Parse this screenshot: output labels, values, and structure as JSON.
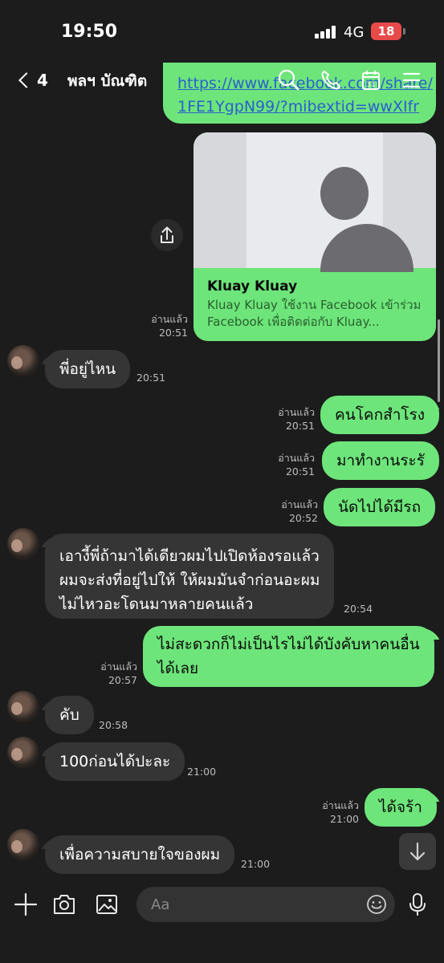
{
  "status_bar": {
    "time": "19:50",
    "network": "4G",
    "battery": "18"
  },
  "header": {
    "back_count": "4",
    "title": "พลฯ บัณฑิต"
  },
  "link_message": {
    "url_line1": "https://www.facebook.com/share/",
    "url_line2": "1FE1YgpN99/?mibextid=wwXIfr"
  },
  "link_card": {
    "title": "Kluay Kluay",
    "description": "Kluay Kluay ใช้งาน Facebook เข้าร่วม Facebook เพื่อติดต่อกับ Kluay...",
    "read": "อ่านแล้ว",
    "time": "20:51"
  },
  "messages": [
    {
      "dir": "in",
      "text": "พี่อยู่ไหน",
      "time": "20:51"
    },
    {
      "dir": "out",
      "text": "คนโคกสำโรง",
      "read": "อ่านแล้ว",
      "time": "20:51"
    },
    {
      "dir": "out",
      "text": "มาทำงานระรั",
      "read": "อ่านแล้ว",
      "time": "20:51"
    },
    {
      "dir": "out",
      "text": "นัดไปได้มีรถ",
      "read": "อ่านแล้ว",
      "time": "20:52"
    },
    {
      "dir": "in",
      "lines": [
        "เอางี้พี่ถ้ามาได้เดียวผมไปเปิดห้องรอแล้ว",
        "ผมจะส่งที่อยู่ไปให้ ให้ผมมันจำก่อนอะผม",
        "ไม่ไหวอะโดนมาหลายคนแล้ว"
      ],
      "time": "20:54"
    },
    {
      "dir": "out",
      "lines": [
        "ไม่สะดวกก็ไม่เป็นไรไม่ได้บังคับหาคนอื่น",
        "ได้เลย"
      ],
      "read": "อ่านแล้ว",
      "time": "20:57"
    },
    {
      "dir": "in",
      "text": "คับ",
      "time": "20:58"
    },
    {
      "dir": "in",
      "text": "100ก่อนได้ปะละ",
      "time": "21:00"
    },
    {
      "dir": "out",
      "text": "ได้จร้า",
      "read": "อ่านแล้ว",
      "time": "21:00"
    },
    {
      "dir": "in",
      "text": "เพื่อความสบายใจของผม",
      "time": "21:00"
    }
  ],
  "input": {
    "placeholder": "Aa"
  },
  "colors": {
    "background": "#1c1c1c",
    "outgoing_bubble": "#6de57a",
    "incoming_bubble": "#353535",
    "link": "#2b5fd1",
    "battery": "#e84a4a"
  }
}
